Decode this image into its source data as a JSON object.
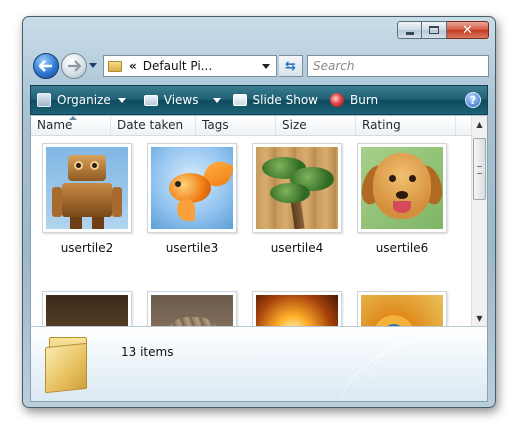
{
  "window": {
    "controls": {
      "minimize": "minimize",
      "maximize": "maximize",
      "close": "✕"
    }
  },
  "address_bar": {
    "chevrons": "«",
    "path": "Default Pi...",
    "refresh_symbol": "⇆"
  },
  "search": {
    "placeholder": "Search"
  },
  "toolbar": {
    "organize": "Organize",
    "views": "Views",
    "slideshow": "Slide Show",
    "burn": "Burn",
    "help": "?"
  },
  "columns": [
    "Name",
    "Date taken",
    "Tags",
    "Size",
    "Rating"
  ],
  "tiles": [
    {
      "caption": "usertile2",
      "image": "robot"
    },
    {
      "caption": "usertile3",
      "image": "goldfish"
    },
    {
      "caption": "usertile4",
      "image": "bonsai"
    },
    {
      "caption": "usertile6",
      "image": "puppy"
    },
    {
      "caption": "",
      "image": "chess"
    },
    {
      "caption": "",
      "image": "cat"
    },
    {
      "caption": "",
      "image": "glow"
    },
    {
      "caption": "",
      "image": "swirl"
    }
  ],
  "details": {
    "count": "13 items"
  },
  "colors": {
    "toolbar": "#1f5f74",
    "accent": "#2f78d2"
  }
}
